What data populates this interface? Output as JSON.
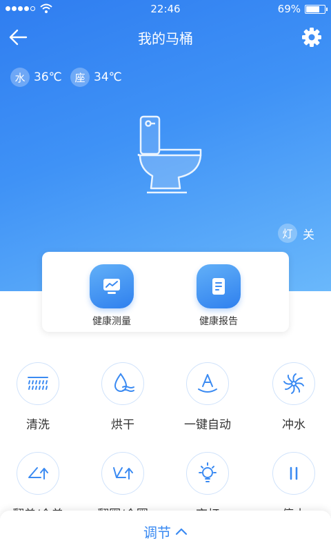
{
  "status": {
    "time": "22:46",
    "battery": "69%",
    "battery_level": 0.69
  },
  "header": {
    "title": "我的马桶"
  },
  "temps": [
    {
      "badge": "水",
      "value": "36℃"
    },
    {
      "badge": "座",
      "value": "34℃"
    }
  ],
  "light": {
    "badge": "灯",
    "state": "关"
  },
  "health": [
    {
      "label": "健康测量",
      "icon": "monitor-chart-icon"
    },
    {
      "label": "健康报告",
      "icon": "report-document-icon"
    }
  ],
  "functions": [
    {
      "label": "清洗",
      "icon": "shower-icon"
    },
    {
      "label": "烘干",
      "icon": "dry-icon"
    },
    {
      "label": "一键自动",
      "icon": "auto-icon"
    },
    {
      "label": "冲水",
      "icon": "flush-icon"
    },
    {
      "label": "翻盖/合盖",
      "icon": "lid-icon"
    },
    {
      "label": "翻圈/合圈",
      "icon": "seat-ring-icon"
    },
    {
      "label": "夜灯",
      "icon": "bulb-icon"
    },
    {
      "label": "停止",
      "icon": "pause-icon"
    }
  ],
  "bottom": {
    "label": "调节"
  },
  "colors": {
    "primary": "#3a8af2",
    "hero_start": "#2f7df0",
    "hero_end": "#6ab8fb"
  }
}
